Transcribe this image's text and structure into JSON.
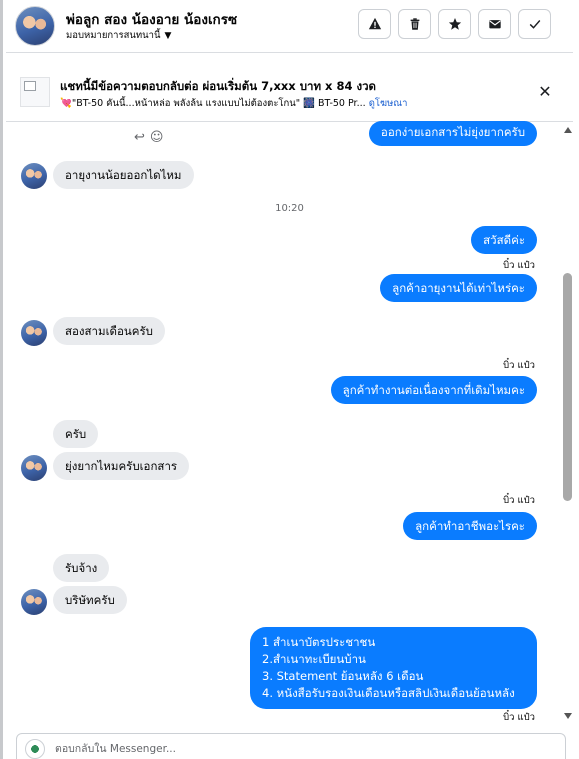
{
  "header": {
    "contact_name": "พ่อลูก สอง น้องอาย น้องเกรซ",
    "assign_label": "มอบหมายการสนทนานี้",
    "actions": [
      {
        "icon": "warning-icon",
        "label": "!"
      },
      {
        "icon": "trash-icon",
        "label": ""
      },
      {
        "icon": "star-icon",
        "label": "★"
      },
      {
        "icon": "envelope-icon",
        "label": "✉"
      },
      {
        "icon": "check-icon",
        "label": "✓"
      }
    ]
  },
  "ad": {
    "title": "แชทนี้มีข้อความตอบกลับต่อ ผ่อนเริ่มต้น 7,xxx บาท x 84 งวด",
    "subtitle": "💘\"BT-50 คันนี้...หน้าหล่อ พลังล้น แรงแบบไม่ต้องตะโกน\" 🎆 BT-50 Pr...",
    "link_label": "ดูโฆษณา",
    "close_icon": "close-icon"
  },
  "messages": [
    {
      "side": "out",
      "text": "ออกง่ายเอกสารไม่ยุ่งยากครับ"
    },
    {
      "side": "in",
      "text": "อายุงานน้อยออกไดไหม"
    },
    {
      "time": "10:20"
    },
    {
      "side": "out",
      "text": "สวัสดีค่ะ"
    },
    {
      "sender": "บิ๋ว แป๋ว"
    },
    {
      "side": "out",
      "text": "ลูกค้าอายุงานได้เท่าไหร่คะ"
    },
    {
      "side": "in",
      "text": "สองสามเดือนครับ"
    },
    {
      "sender": "บิ๋ว แป๋ว"
    },
    {
      "side": "out",
      "text": "ลูกค้าทำงานต่อเนื่องจากที่เดิมไหมคะ"
    },
    {
      "side": "in",
      "text": "ครับ"
    },
    {
      "side": "in",
      "text": "ยุ่งยากไหมครับเอกสาร"
    },
    {
      "sender": "บิ๋ว แป๋ว"
    },
    {
      "side": "out",
      "text": "ลูกค้าทำอาชีพอะไรคะ"
    },
    {
      "side": "in",
      "text": "รับจ้าง"
    },
    {
      "side": "in",
      "text": "บริษัทครับ"
    },
    {
      "side": "out",
      "lines": [
        "1 สำเนาบัตรประชาชน",
        "2.สำเนาทะเบียนบ้าน",
        " 3. Statement ย้อนหลัง 6 เดือน",
        "4. หนังสือรับรองเงินเดือนหรือสลิปเงินเดือนย้อนหลัง"
      ]
    },
    {
      "sender": "บิ๋ว แป๋ว"
    }
  ],
  "composer": {
    "placeholder": "ตอบกลับใน Messenger..."
  }
}
